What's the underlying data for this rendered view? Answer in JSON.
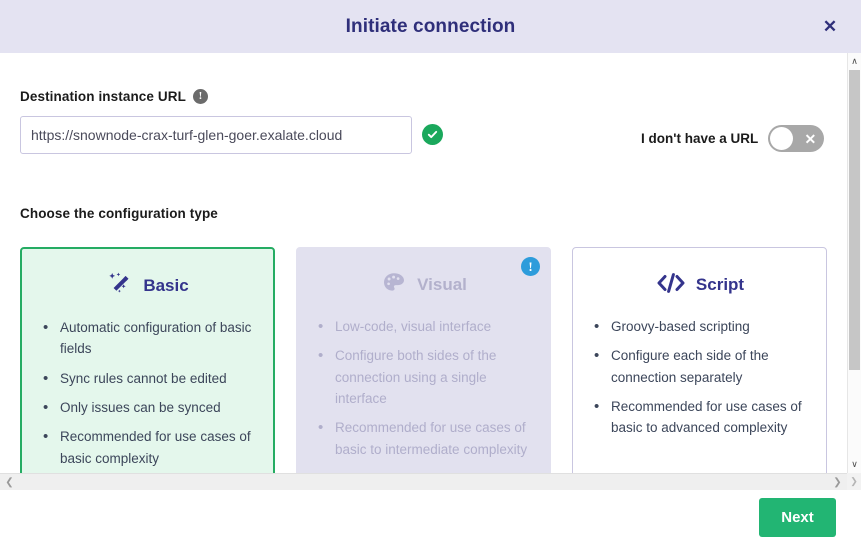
{
  "header": {
    "title": "Initiate connection",
    "close_label": "✕"
  },
  "url_section": {
    "label": "Destination instance URL",
    "info_icon": "info-icon",
    "value": "https://snownode-crax-turf-glen-goer.exalate.cloud",
    "placeholder": "https://",
    "validated": true,
    "no_url_label": "I don't have a URL",
    "toggle_state": "off",
    "toggle_off_glyph": "✕"
  },
  "config_section": {
    "title": "Choose the configuration type",
    "cards": [
      {
        "id": "basic",
        "title": "Basic",
        "icon": "magic-wand-icon",
        "state": "selected",
        "bullets": [
          "Automatic configuration of basic fields",
          "Sync rules cannot be edited",
          "Only issues can be synced",
          "Recommended for use cases of basic complexity"
        ]
      },
      {
        "id": "visual",
        "title": "Visual",
        "icon": "palette-icon",
        "state": "disabled",
        "badge": "!",
        "bullets": [
          "Low-code, visual interface",
          "Configure both sides of the connection using a single interface",
          "Recommended for use cases of basic to intermediate complexity"
        ]
      },
      {
        "id": "script",
        "title": "Script",
        "icon": "code-brackets-icon",
        "state": "default",
        "bullets": [
          "Groovy-based scripting",
          "Configure each side of the connection separately",
          "Recommended for use cases of basic to advanced complexity"
        ]
      }
    ]
  },
  "footer": {
    "next_label": "Next"
  },
  "scrollbars": {
    "up_arrow": "∧",
    "down_arrow": "∨",
    "left_arrow": "❮",
    "right_arrow": "❯",
    "corner_arrow": "❯"
  },
  "colors": {
    "header_bg": "#e4e3f2",
    "title": "#2f2f7a",
    "accent_green": "#22b573",
    "selected_border": "#25ac63",
    "selected_bg": "#e4f7ec",
    "disabled_bg": "#e2e1ef",
    "card_title": "#34348c",
    "badge_blue": "#2d9cdb"
  }
}
